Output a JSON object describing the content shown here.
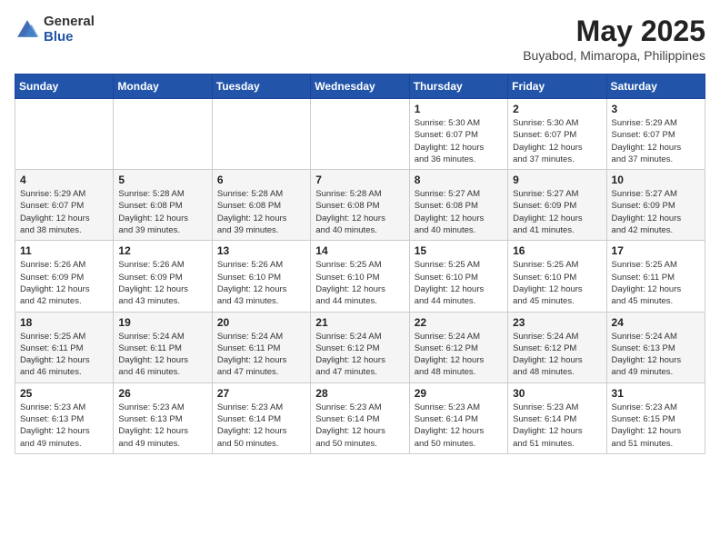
{
  "logo": {
    "general": "General",
    "blue": "Blue"
  },
  "header": {
    "title": "May 2025",
    "location": "Buyabod, Mimaropa, Philippines"
  },
  "weekdays": [
    "Sunday",
    "Monday",
    "Tuesday",
    "Wednesday",
    "Thursday",
    "Friday",
    "Saturday"
  ],
  "weeks": [
    [
      {
        "day": "",
        "info": ""
      },
      {
        "day": "",
        "info": ""
      },
      {
        "day": "",
        "info": ""
      },
      {
        "day": "",
        "info": ""
      },
      {
        "day": "1",
        "info": "Sunrise: 5:30 AM\nSunset: 6:07 PM\nDaylight: 12 hours\nand 36 minutes."
      },
      {
        "day": "2",
        "info": "Sunrise: 5:30 AM\nSunset: 6:07 PM\nDaylight: 12 hours\nand 37 minutes."
      },
      {
        "day": "3",
        "info": "Sunrise: 5:29 AM\nSunset: 6:07 PM\nDaylight: 12 hours\nand 37 minutes."
      }
    ],
    [
      {
        "day": "4",
        "info": "Sunrise: 5:29 AM\nSunset: 6:07 PM\nDaylight: 12 hours\nand 38 minutes."
      },
      {
        "day": "5",
        "info": "Sunrise: 5:28 AM\nSunset: 6:08 PM\nDaylight: 12 hours\nand 39 minutes."
      },
      {
        "day": "6",
        "info": "Sunrise: 5:28 AM\nSunset: 6:08 PM\nDaylight: 12 hours\nand 39 minutes."
      },
      {
        "day": "7",
        "info": "Sunrise: 5:28 AM\nSunset: 6:08 PM\nDaylight: 12 hours\nand 40 minutes."
      },
      {
        "day": "8",
        "info": "Sunrise: 5:27 AM\nSunset: 6:08 PM\nDaylight: 12 hours\nand 40 minutes."
      },
      {
        "day": "9",
        "info": "Sunrise: 5:27 AM\nSunset: 6:09 PM\nDaylight: 12 hours\nand 41 minutes."
      },
      {
        "day": "10",
        "info": "Sunrise: 5:27 AM\nSunset: 6:09 PM\nDaylight: 12 hours\nand 42 minutes."
      }
    ],
    [
      {
        "day": "11",
        "info": "Sunrise: 5:26 AM\nSunset: 6:09 PM\nDaylight: 12 hours\nand 42 minutes."
      },
      {
        "day": "12",
        "info": "Sunrise: 5:26 AM\nSunset: 6:09 PM\nDaylight: 12 hours\nand 43 minutes."
      },
      {
        "day": "13",
        "info": "Sunrise: 5:26 AM\nSunset: 6:10 PM\nDaylight: 12 hours\nand 43 minutes."
      },
      {
        "day": "14",
        "info": "Sunrise: 5:25 AM\nSunset: 6:10 PM\nDaylight: 12 hours\nand 44 minutes."
      },
      {
        "day": "15",
        "info": "Sunrise: 5:25 AM\nSunset: 6:10 PM\nDaylight: 12 hours\nand 44 minutes."
      },
      {
        "day": "16",
        "info": "Sunrise: 5:25 AM\nSunset: 6:10 PM\nDaylight: 12 hours\nand 45 minutes."
      },
      {
        "day": "17",
        "info": "Sunrise: 5:25 AM\nSunset: 6:11 PM\nDaylight: 12 hours\nand 45 minutes."
      }
    ],
    [
      {
        "day": "18",
        "info": "Sunrise: 5:25 AM\nSunset: 6:11 PM\nDaylight: 12 hours\nand 46 minutes."
      },
      {
        "day": "19",
        "info": "Sunrise: 5:24 AM\nSunset: 6:11 PM\nDaylight: 12 hours\nand 46 minutes."
      },
      {
        "day": "20",
        "info": "Sunrise: 5:24 AM\nSunset: 6:11 PM\nDaylight: 12 hours\nand 47 minutes."
      },
      {
        "day": "21",
        "info": "Sunrise: 5:24 AM\nSunset: 6:12 PM\nDaylight: 12 hours\nand 47 minutes."
      },
      {
        "day": "22",
        "info": "Sunrise: 5:24 AM\nSunset: 6:12 PM\nDaylight: 12 hours\nand 48 minutes."
      },
      {
        "day": "23",
        "info": "Sunrise: 5:24 AM\nSunset: 6:12 PM\nDaylight: 12 hours\nand 48 minutes."
      },
      {
        "day": "24",
        "info": "Sunrise: 5:24 AM\nSunset: 6:13 PM\nDaylight: 12 hours\nand 49 minutes."
      }
    ],
    [
      {
        "day": "25",
        "info": "Sunrise: 5:23 AM\nSunset: 6:13 PM\nDaylight: 12 hours\nand 49 minutes."
      },
      {
        "day": "26",
        "info": "Sunrise: 5:23 AM\nSunset: 6:13 PM\nDaylight: 12 hours\nand 49 minutes."
      },
      {
        "day": "27",
        "info": "Sunrise: 5:23 AM\nSunset: 6:14 PM\nDaylight: 12 hours\nand 50 minutes."
      },
      {
        "day": "28",
        "info": "Sunrise: 5:23 AM\nSunset: 6:14 PM\nDaylight: 12 hours\nand 50 minutes."
      },
      {
        "day": "29",
        "info": "Sunrise: 5:23 AM\nSunset: 6:14 PM\nDaylight: 12 hours\nand 50 minutes."
      },
      {
        "day": "30",
        "info": "Sunrise: 5:23 AM\nSunset: 6:14 PM\nDaylight: 12 hours\nand 51 minutes."
      },
      {
        "day": "31",
        "info": "Sunrise: 5:23 AM\nSunset: 6:15 PM\nDaylight: 12 hours\nand 51 minutes."
      }
    ]
  ]
}
